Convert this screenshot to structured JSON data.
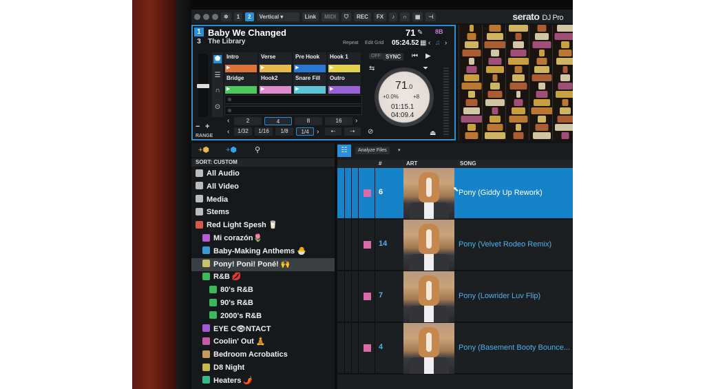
{
  "app": {
    "logo": "serato",
    "edition": "DJ Pro"
  },
  "topbar": {
    "deck_buttons": [
      "1",
      "2"
    ],
    "layout_select": "Vertical",
    "buttons": [
      "Link",
      "MIDI",
      "REC",
      "FX"
    ]
  },
  "deck": {
    "number": "1",
    "sub_number": "3",
    "title": "Baby We Changed",
    "artist": "The Library",
    "bpm": "71",
    "key": "8B",
    "repeat_label": "Repeat",
    "edit_grid_label": "Edit Grid",
    "remaining_time": "05:24.52",
    "sync_label": "SYNC",
    "off_label": "OFF",
    "range_label": "RANGE",
    "pitch_minus": "−",
    "pitch_plus": "+",
    "cues": [
      {
        "label": "Intro",
        "color": "#e0733a"
      },
      {
        "label": "Verse",
        "color": "#e8b84a"
      },
      {
        "label": "Pre Hook",
        "color": "#2a78d6"
      },
      {
        "label": "Hook 1",
        "color": "#e6d24a"
      },
      {
        "label": "Bridge",
        "color": "#4ec85a"
      },
      {
        "label": "Hook2",
        "color": "#e08ad0"
      },
      {
        "label": "Snare Fill",
        "color": "#5cc6d8"
      },
      {
        "label": "Outro",
        "color": "#9a62d6"
      }
    ],
    "loop_row1": [
      "2",
      "4",
      "8",
      "16"
    ],
    "loop_row2": [
      "1/32",
      "1/16",
      "1/8",
      "1/4"
    ],
    "platter": {
      "bpm": "71",
      "bpm_decimal": ".0",
      "pitch_pct": "+0.0%",
      "pitch_plus": "+8",
      "elapsed": "01:15.1",
      "remaining": "04:09.4"
    }
  },
  "library": {
    "sort_label": "SORT: CUSTOM",
    "crates": [
      {
        "label": "All Audio",
        "icon": "speaker-icon",
        "color": "#bbbbbb",
        "indent": 0
      },
      {
        "label": "All Video",
        "icon": "film-icon",
        "color": "#bbbbbb",
        "indent": 0
      },
      {
        "label": "Media",
        "icon": "media-icon",
        "color": "#bbbbbb",
        "indent": 0
      },
      {
        "label": "Stems",
        "icon": "stems-icon",
        "color": "#bbbbbb",
        "indent": 0
      },
      {
        "label": "Red Light Spesh 🥛",
        "icon": "crate-icon",
        "color": "#d45a4a",
        "indent": 0
      },
      {
        "label": "Mi corazón🌷",
        "icon": "crate-icon",
        "color": "#b65ad6",
        "indent": 1
      },
      {
        "label": "Baby-Making Anthems 🐣",
        "icon": "crate-icon",
        "color": "#3a9ad6",
        "indent": 1
      },
      {
        "label": "Pony! Poni! Poné! 🙌",
        "icon": "crate-icon",
        "color": "#c6c26a",
        "indent": 1
      },
      {
        "label": "R&B 💋",
        "icon": "crate-icon",
        "color": "#3ab85a",
        "indent": 1
      },
      {
        "label": "80's R&B",
        "icon": "crate-icon",
        "color": "#3ab85a",
        "indent": 2
      },
      {
        "label": "90's R&B",
        "icon": "crate-icon",
        "color": "#3ab85a",
        "indent": 2
      },
      {
        "label": "2000's R&B",
        "icon": "crate-icon",
        "color": "#3ab85a",
        "indent": 2
      },
      {
        "label": "EYE C👁NTACT",
        "icon": "crate-icon",
        "color": "#a45ad6",
        "indent": 1
      },
      {
        "label": "Coolin' Out 🧘",
        "icon": "crate-icon",
        "color": "#c65aa8",
        "indent": 1
      },
      {
        "label": "Bedroom Acrobatics",
        "icon": "crate-icon",
        "color": "#c69a5a",
        "indent": 1
      },
      {
        "label": "D8 Night",
        "icon": "crate-icon",
        "color": "#c6b84a",
        "indent": 1
      },
      {
        "label": "Heaters 🌶️",
        "icon": "crate-icon",
        "color": "#3ab88a",
        "indent": 1
      }
    ],
    "selected_crate_index": 7
  },
  "tracks": {
    "analyze_label": "Analyze Files",
    "columns": [
      "#",
      "ART",
      "SONG"
    ],
    "rows": [
      {
        "num": "6",
        "song": "Pony (Giddy Up Rework)",
        "selected": true
      },
      {
        "num": "14",
        "song": "Pony (Velvet Rodeo Remix)",
        "selected": false
      },
      {
        "num": "7",
        "song": "Pony (Lowrider Luv Flip)",
        "selected": false
      },
      {
        "num": "4",
        "song": "Pony (Basement Booty Bounce...",
        "selected": false
      }
    ]
  },
  "colors": {
    "accent": "#2a8fd6",
    "selection": "#1683c9",
    "link": "#4fb0f0"
  }
}
